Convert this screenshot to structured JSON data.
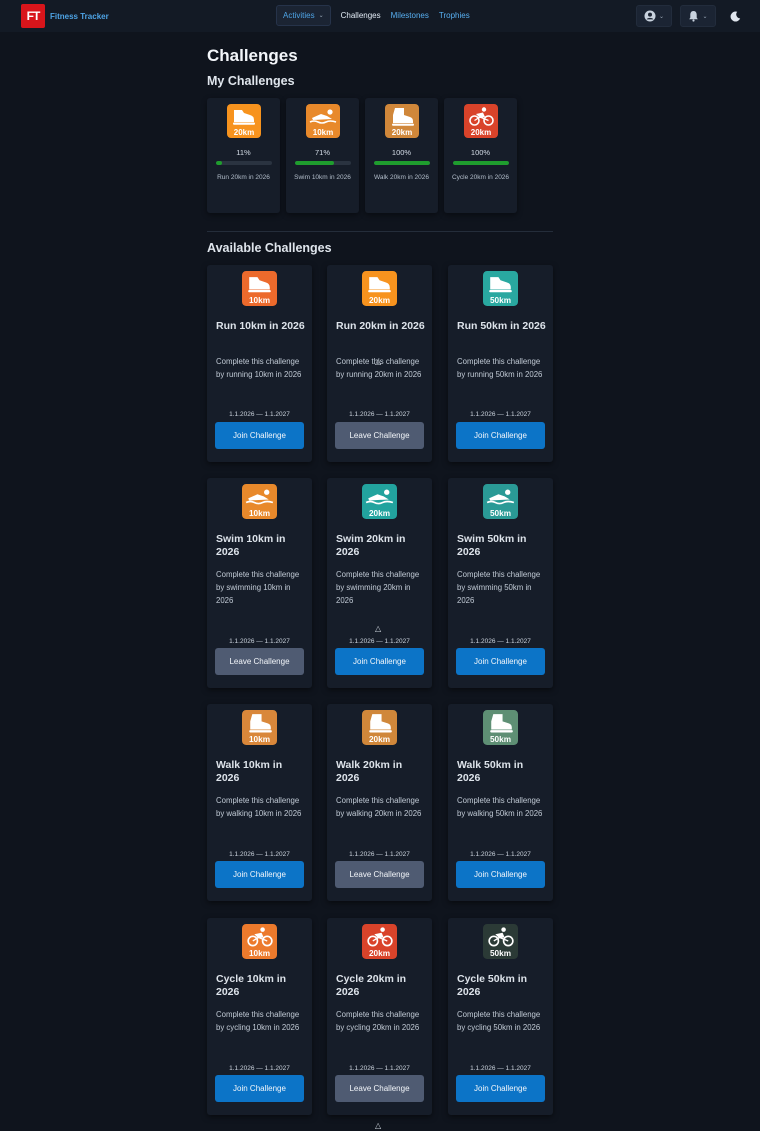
{
  "nav": {
    "logo_text": "FT",
    "brand": "Fitness Tracker",
    "activities": "Activities",
    "links": [
      "Challenges",
      "Milestones",
      "Trophies"
    ]
  },
  "page": {
    "title": "Challenges",
    "my_heading": "My Challenges",
    "available_heading": "Available Challenges"
  },
  "my_challenges": [
    {
      "km": "20km",
      "type": "run",
      "color": "#f7931e",
      "percent": "11%",
      "progress": 0.11,
      "label": "Run 20km in 2026"
    },
    {
      "km": "10km",
      "type": "swim",
      "color": "#e8892b",
      "percent": "71%",
      "progress": 0.71,
      "label": "Swim 10km in 2026"
    },
    {
      "km": "20km",
      "type": "walk",
      "color": "#d0873a",
      "percent": "100%",
      "progress": 1.0,
      "label": "Walk 20km in 2026"
    },
    {
      "km": "20km",
      "type": "cycle",
      "color": "#d9432a",
      "percent": "100%",
      "progress": 1.0,
      "label": "Cycle 20km in 2026"
    }
  ],
  "challenges": [
    {
      "title": "Run 10km in 2026",
      "desc": "Complete this challenge by running 10km in 2026",
      "dates": "1.1.2026 — 1.1.2027",
      "button": "Join Challenge",
      "state": "join",
      "km": "10km",
      "type": "run",
      "color": "#ec6a2c"
    },
    {
      "title": "Run 20km in 2026",
      "desc": "Complete this challenge by running 20km in 2026",
      "dates": "1.1.2026 — 1.1.2027",
      "button": "Leave Challenge",
      "state": "leave",
      "km": "20km",
      "type": "run",
      "color": "#f7931e"
    },
    {
      "title": "Run 50km in 2026",
      "desc": "Complete this challenge by running 50km in 2026",
      "dates": "1.1.2026 — 1.1.2027",
      "button": "Join Challenge",
      "state": "join",
      "km": "50km",
      "type": "run",
      "color": "#29a8a0"
    },
    {
      "title": "Swim 10km in 2026",
      "desc": "Complete this challenge by swimming 10km in 2026",
      "dates": "1.1.2026 — 1.1.2027",
      "button": "Leave Challenge",
      "state": "leave",
      "km": "10km",
      "type": "swim",
      "color": "#e8892b"
    },
    {
      "title": "Swim 20km in 2026",
      "desc": "Complete this challenge by swimming 20km in 2026",
      "dates": "1.1.2026 — 1.1.2027",
      "button": "Join Challenge",
      "state": "join",
      "km": "20km",
      "type": "swim",
      "color": "#22a39e"
    },
    {
      "title": "Swim 50km in 2026",
      "desc": "Complete this challenge by swimming 50km in 2026",
      "dates": "1.1.2026 — 1.1.2027",
      "button": "Join Challenge",
      "state": "join",
      "km": "50km",
      "type": "swim",
      "color": "#2a9a96"
    },
    {
      "title": "Walk 10km in 2026",
      "desc": "Complete this challenge by walking 10km in 2026",
      "dates": "1.1.2026 — 1.1.2027",
      "button": "Join Challenge",
      "state": "join",
      "km": "10km",
      "type": "walk",
      "color": "#d9873a"
    },
    {
      "title": "Walk 20km in 2026",
      "desc": "Complete this challenge by walking 20km in 2026",
      "dates": "1.1.2026 — 1.1.2027",
      "button": "Leave Challenge",
      "state": "leave",
      "km": "20km",
      "type": "walk",
      "color": "#d0873a"
    },
    {
      "title": "Walk 50km in 2026",
      "desc": "Complete this challenge by walking 50km in 2026",
      "dates": "1.1.2026 — 1.1.2027",
      "button": "Join Challenge",
      "state": "join",
      "km": "50km",
      "type": "walk",
      "color": "#5e8f74"
    },
    {
      "title": "Cycle 10km in 2026",
      "desc": "Complete this challenge by cycling 10km in 2026",
      "dates": "1.1.2026 — 1.1.2027",
      "button": "Join Challenge",
      "state": "join",
      "km": "10km",
      "type": "cycle",
      "color": "#ec7a2c"
    },
    {
      "title": "Cycle 20km in 2026",
      "desc": "Complete this challenge by cycling 20km in 2026",
      "dates": "1.1.2026 — 1.1.2027",
      "button": "Leave Challenge",
      "state": "leave",
      "km": "20km",
      "type": "cycle",
      "color": "#d9432a"
    },
    {
      "title": "Cycle 50km in 2026",
      "desc": "Complete this challenge by cycling 50km in 2026",
      "dates": "1.1.2026 — 1.1.2027",
      "button": "Join Challenge",
      "state": "join",
      "km": "50km",
      "type": "cycle",
      "color": "#2b3a36"
    }
  ]
}
